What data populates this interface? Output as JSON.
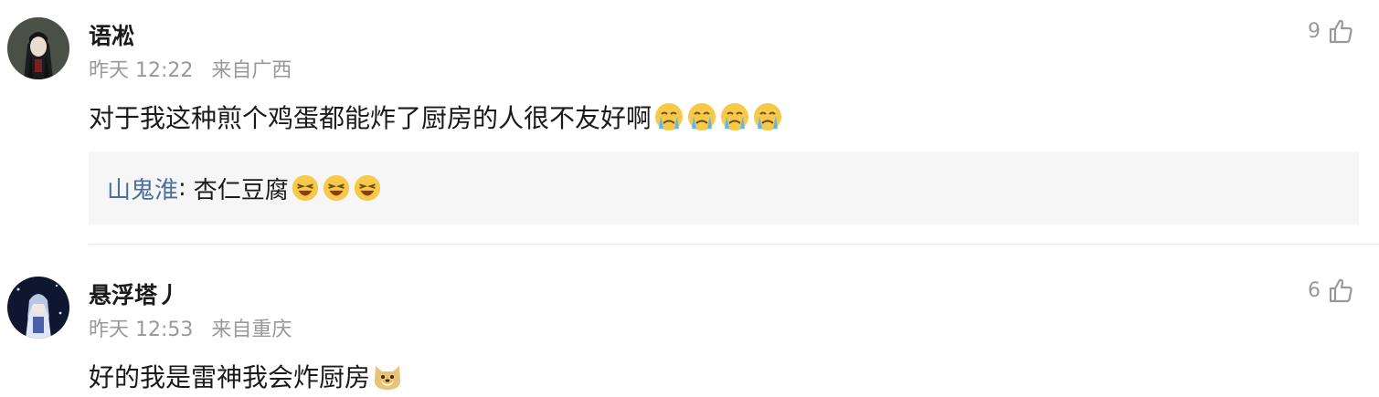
{
  "comments": [
    {
      "username": "语凇",
      "time": "昨天 12:22",
      "location": "来自广西",
      "text": "对于我这种煎个鸡蛋都能炸了厨房的人很不友好啊",
      "text_emojis": [
        "crying-face-emoji",
        "crying-face-emoji",
        "crying-face-emoji",
        "crying-face-emoji"
      ],
      "likes": "9",
      "reply": {
        "name": "山鬼淮",
        "colon": ":",
        "text": "杏仁豆腐",
        "emojis": [
          "laughing-face-emoji",
          "laughing-face-emoji",
          "laughing-face-emoji"
        ]
      }
    },
    {
      "username": "悬浮塔丿",
      "time": "昨天 12:53",
      "location": "来自重庆",
      "text": "好的我是雷神我会炸厨房",
      "text_emojis": [
        "doge-emoji"
      ],
      "likes": "6"
    }
  ],
  "colors": {
    "reply_name": "#4a6f9e",
    "meta_gray": "#999999",
    "reply_bg": "#f6f6f6"
  }
}
